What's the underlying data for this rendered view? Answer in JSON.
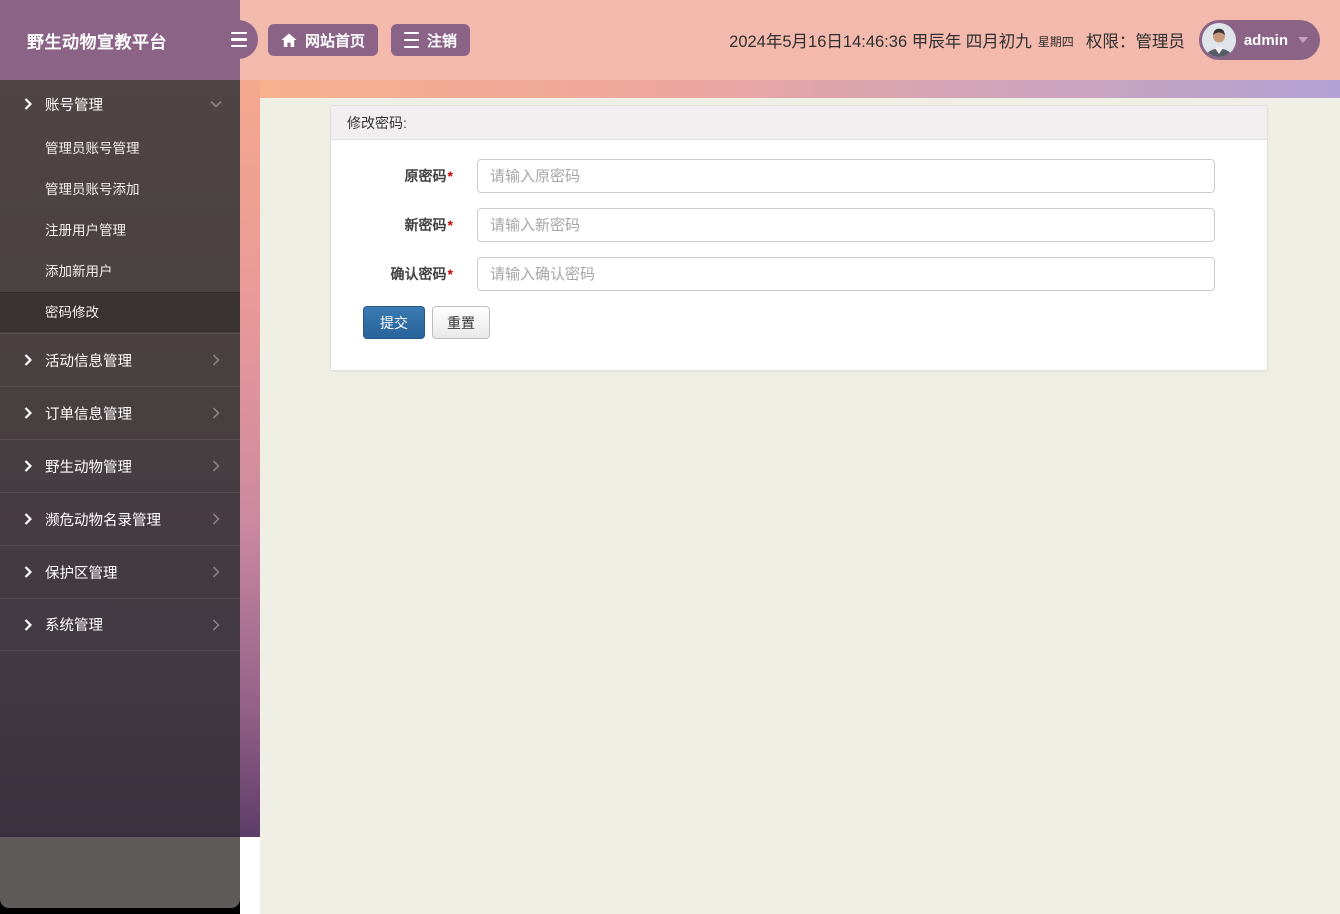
{
  "app": {
    "title": "野生动物宣教平台"
  },
  "navbar": {
    "home_button": "网站首页",
    "logout_button": "注销",
    "datetime": "2024年5月16日14:46:36 甲辰年 四月初九",
    "weekday": "星期四",
    "permission": "权限：管理员",
    "username": "admin"
  },
  "sidebar": {
    "account_group": {
      "label": "账号管理",
      "children": [
        "管理员账号管理",
        "管理员账号添加",
        "注册用户管理",
        "添加新用户",
        "密码修改"
      ],
      "active_child": "密码修改"
    },
    "top_items": [
      "活动信息管理",
      "订单信息管理",
      "野生动物管理",
      "濒危动物名录管理",
      "保护区管理",
      "系统管理"
    ]
  },
  "form": {
    "panel_title": "修改密码:",
    "required_mark": "*",
    "fields": [
      {
        "label": "原密码",
        "placeholder": "请输入原密码"
      },
      {
        "label": "新密码",
        "placeholder": "请输入新密码"
      },
      {
        "label": "确认密码",
        "placeholder": "请输入确认密码"
      }
    ],
    "submit_label": "提交",
    "reset_label": "重置"
  },
  "colors": {
    "navbar_bg": "#f2b9ac",
    "brand_purple": "#8a6387",
    "sidebar_top": "#4f4544",
    "sidebar_bottom": "#3a313e",
    "content_bg": "#f0efe6",
    "submit_blue": "#2e6da4",
    "required_red": "#cc0000",
    "backdrop_gradient_start": "#f6ad8b",
    "backdrop_gradient_end": "#5d3d68"
  }
}
